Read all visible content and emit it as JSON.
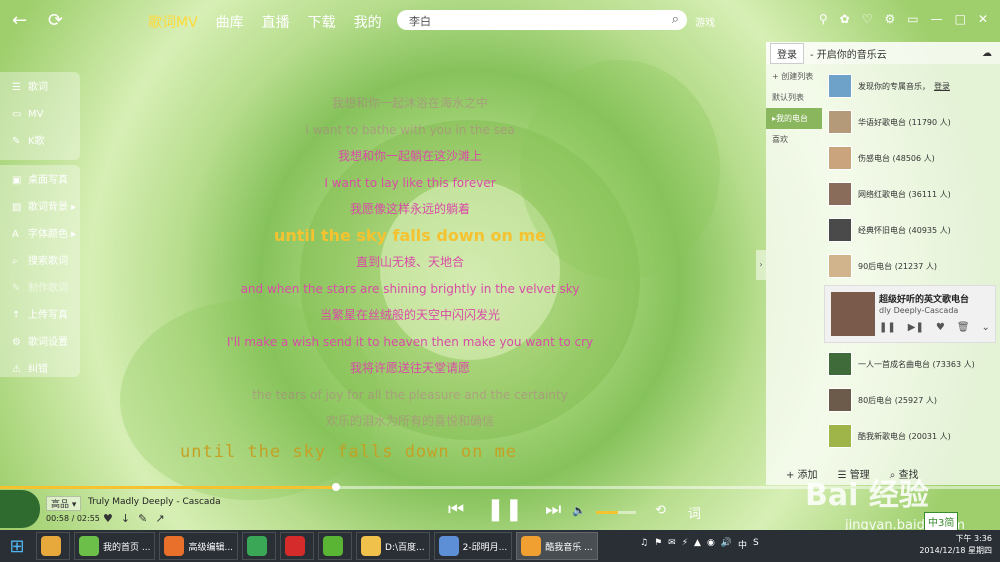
{
  "nav": {
    "back": "←",
    "refresh": "⟳"
  },
  "tabs": [
    "歌词MV",
    "曲库",
    "直播",
    "下载",
    "我的"
  ],
  "search": {
    "value": "李白"
  },
  "game_label": "游戏",
  "window_controls": [
    "⚲",
    "✿",
    "♡",
    "⚙",
    "▭",
    "—",
    "□",
    "✕"
  ],
  "left_menu_top": [
    {
      "icon": "☰",
      "label": "歌词"
    },
    {
      "icon": "▭",
      "label": "MV"
    },
    {
      "icon": "✎",
      "label": "K歌"
    }
  ],
  "left_menu_bottom": [
    {
      "icon": "▣",
      "label": "桌面写真"
    },
    {
      "icon": "▨",
      "label": "歌词背景 ▸"
    },
    {
      "icon": "A",
      "label": "字体颜色 ▸"
    },
    {
      "icon": "⌕",
      "label": "搜索歌词"
    },
    {
      "icon": "✎",
      "label": "制作歌词"
    },
    {
      "icon": "↑",
      "label": "上传写真"
    },
    {
      "icon": "⚙",
      "label": "歌词设置"
    },
    {
      "icon": "⚠",
      "label": "纠错"
    }
  ],
  "lyrics": [
    {
      "text": "我想和你一起沐浴在海水之中",
      "style": "faded"
    },
    {
      "text": "I want to bathe with you in the sea",
      "style": "faded"
    },
    {
      "text": "我想和你一起躺在这沙滩上",
      "style": "normal"
    },
    {
      "text": "I want to lay like this forever",
      "style": "normal"
    },
    {
      "text": "我愿像这样永远的躺着",
      "style": "normal"
    },
    {
      "text": "until the sky falls down on me",
      "style": "current"
    },
    {
      "text": "直到山无棱、天地合",
      "style": "normal"
    },
    {
      "text": "and when the stars are shining brightly in the velvet sky",
      "style": "normal"
    },
    {
      "text": "当繁星在丝绒般的天空中闪闪发光",
      "style": "normal"
    },
    {
      "text": "I'll make a wish send it to heaven then make you want to cry",
      "style": "normal"
    },
    {
      "text": "我将许愿送往天堂请愿",
      "style": "normal"
    },
    {
      "text": "the tears of joy for all the pleasure and the certainty",
      "style": "faded"
    },
    {
      "text": "欢乐的泪水为所有的喜悦和确信",
      "style": "faded"
    }
  ],
  "big_lyric": "until the sky falls down on me",
  "right_panel": {
    "login": "登录",
    "slogan": "- 开启你的音乐云",
    "side": [
      {
        "label": "+ 创建列表",
        "selected": false
      },
      {
        "label": "默认列表",
        "selected": false
      },
      {
        "label": "▸我的电台",
        "selected": true
      },
      {
        "label": "喜欢",
        "selected": false
      }
    ],
    "promo": "发现你的专属音乐，",
    "promo_link": "登录",
    "stations": [
      "华语好歌电台 (11790 人)",
      "伤感电台 (48506 人)",
      "网络红歌电台 (36111 人)",
      "经典怀旧电台 (40935 人)",
      "90后电台 (21237 人)"
    ],
    "featured": {
      "title": "超级好听的英文歌电台",
      "subtitle": "dly Deeply-Cascada",
      "controls": [
        "❚❚",
        "▶❚",
        "♥",
        "🗑",
        "⌄"
      ]
    },
    "stations_after": [
      "一人一首成名曲电台 (73363 人)",
      "80后电台 (25927 人)",
      "酷我新歌电台 (20031 人)"
    ],
    "footer": [
      "+ 添加",
      "☰ 管理",
      "⌕ 查找"
    ]
  },
  "player": {
    "quality": "高品 ▾",
    "song": "Truly Madly Deeply - Cascada",
    "time": "00:58 / 02:55",
    "progress": 0.336,
    "volume": 0.55,
    "bottom_icons": [
      "♥",
      "↓",
      "✎",
      "↗"
    ],
    "controls": [
      "⏮",
      "❚❚",
      "⏭"
    ],
    "volume_icon": "🔈",
    "right_icons": [
      "⟲",
      "词"
    ]
  },
  "watermark": {
    "main": "Bai 经验",
    "sub": "jingyan.baidu.com"
  },
  "ime": "中3简",
  "taskbar": {
    "items": [
      {
        "label": "",
        "color": "#e7a93b"
      },
      {
        "label": "我的首页 ...",
        "color": "#6cc04a"
      },
      {
        "label": "高级编辑...",
        "color": "#e8702a"
      },
      {
        "label": "",
        "color": "#3aa757"
      },
      {
        "label": "",
        "color": "#d62b2b"
      },
      {
        "label": "",
        "color": "#5bb534"
      },
      {
        "label": "D:\\百度...",
        "color": "#f0c24b"
      },
      {
        "label": "2-邱明月...",
        "color": "#5c8fd6"
      },
      {
        "label": "酷我音乐 ...",
        "color": "#f0a030"
      }
    ],
    "clock_time": "下午 3:36",
    "clock_date": "2014/12/18 星期四",
    "tray": [
      "♫",
      "⚑",
      "✉",
      "⚡",
      "▲",
      "◉",
      "🔊",
      "中",
      "S"
    ]
  }
}
